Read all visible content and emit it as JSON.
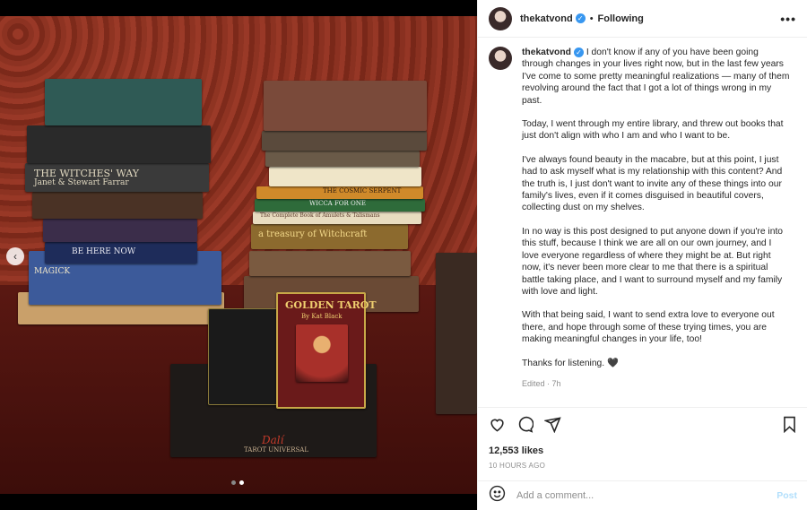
{
  "header": {
    "username": "thekatvond",
    "verified_glyph": "✓",
    "separator": "•",
    "follow_status": "Following",
    "more_glyph": "•••"
  },
  "caption": {
    "username": "thekatvond",
    "paragraphs": [
      "I don't know if any of you have been going through changes in your lives right now, but in the last few years I've come to some pretty meaningful realizations — many of them revolving around the fact that I got a lot of things wrong in my past.",
      "Today, I went through my entire library, and threw out books that just don't align with who I am and who I want to be.",
      "I've always found beauty in the macabre, but at this point, I just had to ask myself what is my relationship with this content? And the truth is, I just don't want to invite any of these things into our family's lives, even if it comes disguised in beautiful covers, collecting dust on my shelves.",
      "In no way is this post designed to put anyone down if you're into this stuff, because I think we are all on our own journey, and I love everyone regardless of where they might be at. But right now, it's never been more clear to me that there is a spiritual battle taking place, and I want to surround myself and my family with love and light.",
      "With that being said, I want to send extra love to everyone out there, and hope through some of these trying times, you are making meaningful changes in your life, too!",
      "Thanks for listening. 🖤"
    ],
    "edited": "Edited · 7h"
  },
  "actions": {
    "like_icon": "heart-icon",
    "comment_icon": "comment-icon",
    "share_icon": "share-icon",
    "save_icon": "bookmark-icon",
    "likes": "12,553 likes",
    "timestamp": "10 HOURS AGO"
  },
  "comment_box": {
    "placeholder": "Add a comment...",
    "post_label": "Post"
  },
  "media": {
    "prev_glyph": "‹",
    "carousel_index": 2,
    "carousel_count": 2,
    "book_titles": {
      "witches_way": "THE WITCHES' WAY",
      "witches_way_authors": "Janet & Stewart Farrar",
      "be_here_now": "BE HERE NOW",
      "magick": "MAGICK",
      "golden_tarot": "GOLDEN TAROT",
      "golden_tarot_author": "By Kat Black",
      "treasury": "a treasury of Witchcraft",
      "wicca": "WICCA FOR ONE",
      "cosmic_serpent": "THE COSMIC SERPENT",
      "amulets": "The Complete Book of Amulets & Talismans",
      "tarot_universal": "TAROT UNIVERSAL",
      "dali": "Dalí"
    }
  },
  "colors": {
    "accent": "#3897f0",
    "post_disabled": "#b2dffc"
  }
}
